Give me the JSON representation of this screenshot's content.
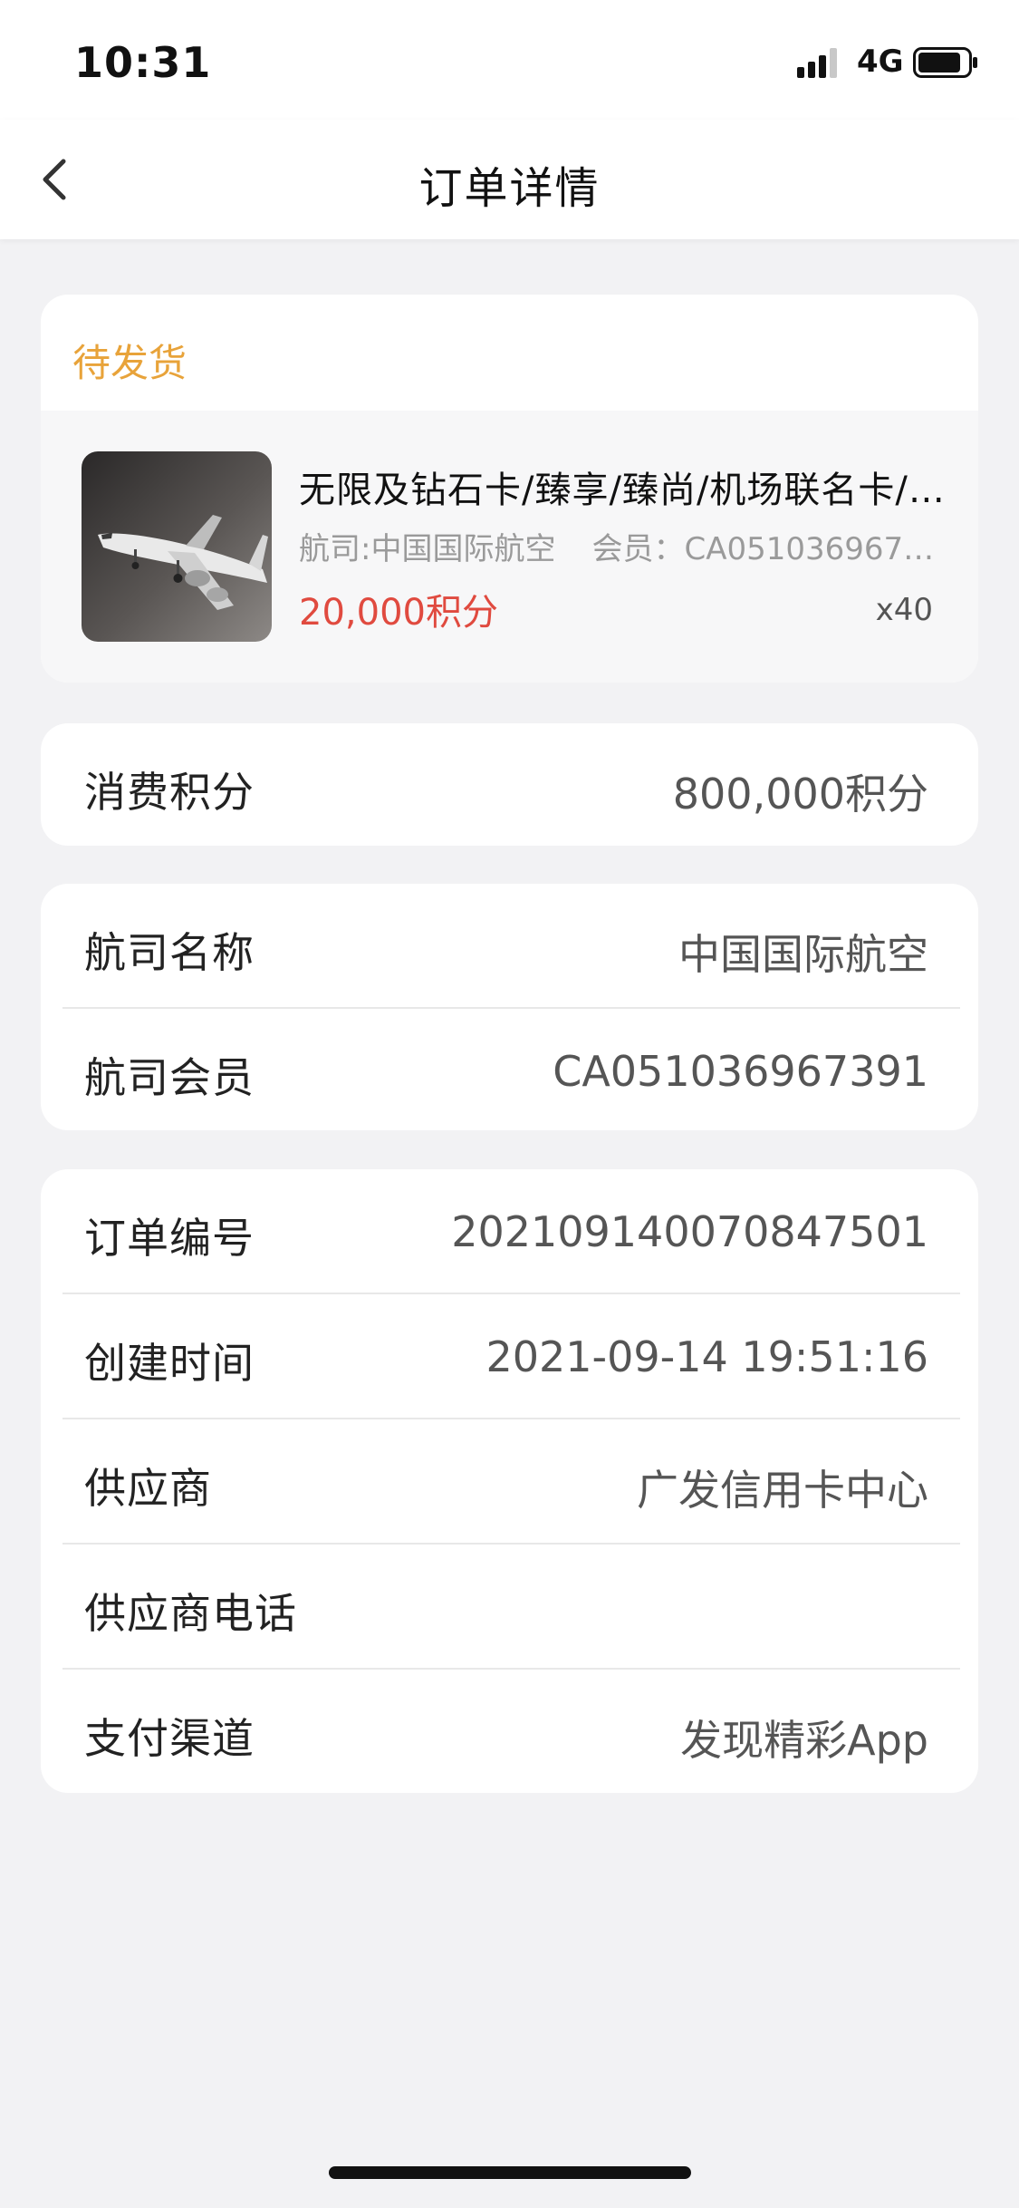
{
  "status_bar": {
    "time": "10:31",
    "network": "4G",
    "signal_icon": "signal-bars-icon",
    "battery_icon": "battery-icon"
  },
  "nav": {
    "title": "订单详情",
    "back_icon": "back-chevron-icon"
  },
  "order_status": {
    "text": "待发货",
    "color": "#e8a33a"
  },
  "product": {
    "name": "无限及钻石卡/臻享/臻尚/机场联名卡/…",
    "airline_meta": "航司:中国国际航空",
    "member_meta": "会员：CA051036967391",
    "price": "20,000积分",
    "quantity": "x40",
    "price_color": "#e04a3f"
  },
  "points": {
    "label": "消费积分",
    "value": "800,000积分"
  },
  "airline_info": {
    "rows": [
      {
        "label": "航司名称",
        "value": "中国国际航空"
      },
      {
        "label": "航司会员",
        "value": "CA051036967391"
      }
    ]
  },
  "order_info": {
    "rows": [
      {
        "label": "订单编号",
        "value": "202109140070847501"
      },
      {
        "label": "创建时间",
        "value": "2021-09-14 19:51:16"
      },
      {
        "label": "供应商",
        "value": "广发信用卡中心"
      },
      {
        "label": "供应商电话",
        "value": ""
      },
      {
        "label": "支付渠道",
        "value": "发现精彩App"
      }
    ]
  }
}
